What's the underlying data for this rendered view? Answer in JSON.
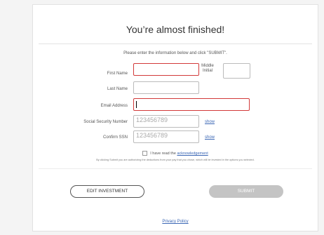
{
  "title": "You’re almost finished!",
  "instructions": "Please enter the information below and click \"SUBMIT\".",
  "fields": {
    "first_name": {
      "label": "First Name",
      "value": ""
    },
    "middle_initial": {
      "label_line1": "Middle",
      "label_line2": "Initial",
      "value": ""
    },
    "last_name": {
      "label": "Last Name",
      "value": ""
    },
    "email": {
      "label": "Email Address",
      "value": ""
    },
    "ssn": {
      "label": "Social Security Number",
      "placeholder": "123456789",
      "show_label": "show"
    },
    "confirm_ssn": {
      "label": "Confirm SSN",
      "placeholder": "123456789",
      "show_label": "show"
    }
  },
  "acknowledgement": {
    "prefix": "I have read the",
    "link": "acknowledgement"
  },
  "fine_print": "By clicking Submit you are authorizing the deductions from your pay that you chose, which will be invested in the options you selected.",
  "buttons": {
    "edit": "EDIT INVESTMENT",
    "submit": "SUBMIT"
  },
  "privacy_link": "Privacy Policy",
  "colors": {
    "error_border": "#d23a3a",
    "link": "#3b67b5",
    "submit_disabled": "#c4c4c4"
  }
}
